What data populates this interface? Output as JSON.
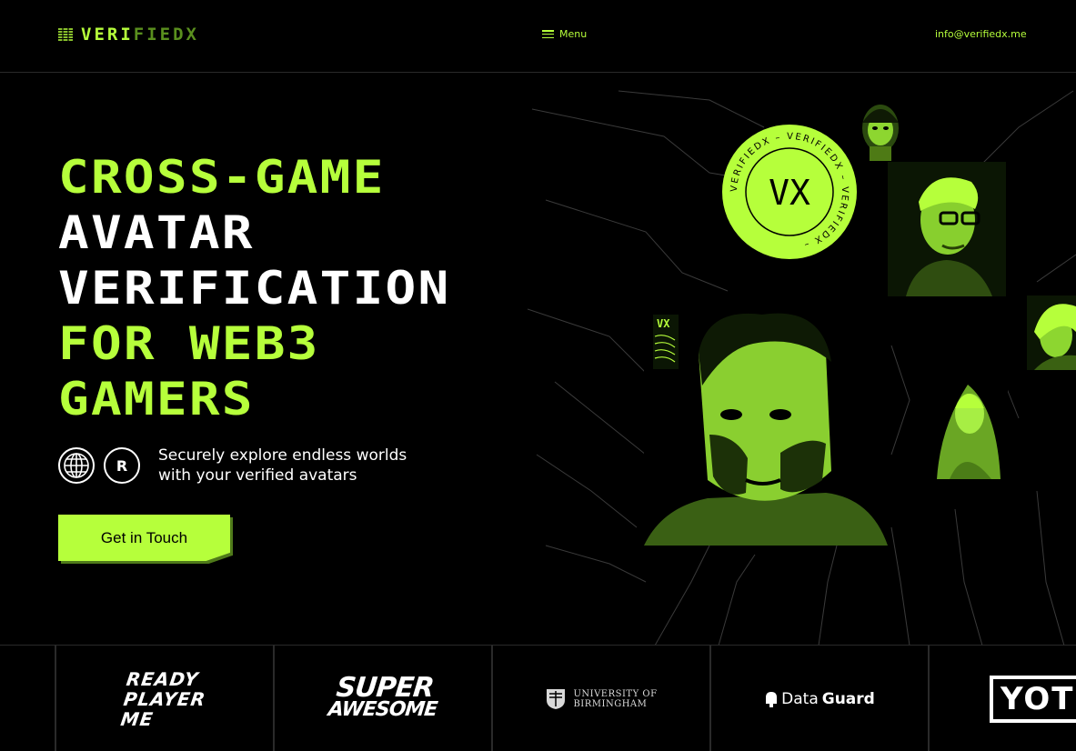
{
  "header": {
    "logo_left": "VERI",
    "logo_right": "FIEDX",
    "menu_label": "Menu",
    "email": "info@verifiedx.me"
  },
  "hero": {
    "headline": [
      {
        "text": "CROSS-GAME",
        "color": "green"
      },
      {
        "text": "AVATAR",
        "color": "white"
      },
      {
        "text": "VERIFICATION",
        "color": "white"
      },
      {
        "text": "FOR WEB3",
        "color": "green"
      },
      {
        "text": "GAMERS",
        "color": "green"
      }
    ],
    "feature_line1": "Securely explore endless worlds",
    "feature_line2": "with your verified avatars",
    "feature_icons": [
      "globe-icon",
      "r-badge-icon"
    ],
    "r_badge": "R",
    "cta_label": "Get in Touch",
    "seal_text": "VERIFIEDX – VERIFIEDX – VERIFIEDX –",
    "seal_mark": "VX",
    "card_mark": "VX"
  },
  "partners": {
    "rpm": [
      "READY",
      "PLAYER",
      "ME"
    ],
    "superawesome": [
      "SUPER",
      "AWESOME"
    ],
    "uob": [
      "UNIVERSITY OF",
      "BIRMINGHAM"
    ],
    "dataguard_a": "Data",
    "dataguard_b": "Guard",
    "yoti": "YOTI"
  },
  "colors": {
    "accent": "#b6ff3b",
    "background": "#000000",
    "text": "#ffffff",
    "divider": "#2a2a2a"
  }
}
